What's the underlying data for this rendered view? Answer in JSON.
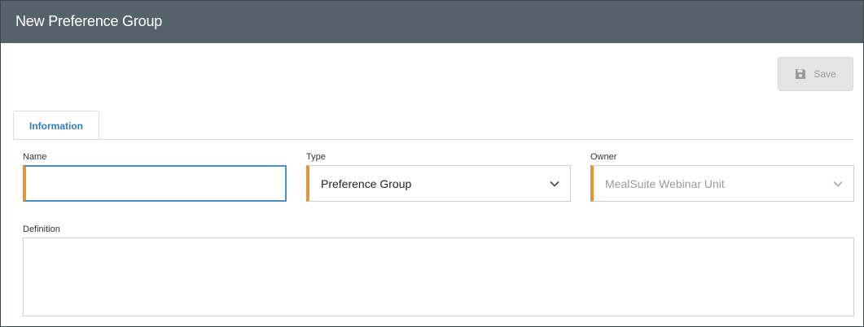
{
  "header": {
    "title": "New Preference Group"
  },
  "toolbar": {
    "save_label": "Save",
    "save_icon": "floppy-disk-icon"
  },
  "tabs": [
    {
      "label": "Information",
      "active": true
    }
  ],
  "form": {
    "name": {
      "label": "Name",
      "value": ""
    },
    "type": {
      "label": "Type",
      "value": "Preference Group"
    },
    "owner": {
      "label": "Owner",
      "value": "MealSuite Webinar Unit",
      "disabled": true
    },
    "definition": {
      "label": "Definition",
      "value": ""
    }
  },
  "colors": {
    "header_bg": "#56626a",
    "accent_required": "#e0963a",
    "focus_border": "#4a90c6",
    "tab_text": "#2f7cc1"
  }
}
